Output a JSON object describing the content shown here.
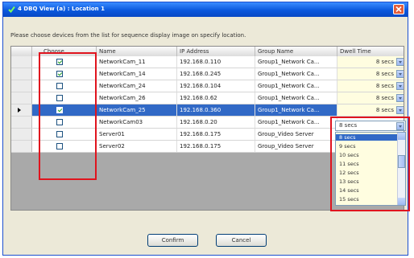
{
  "window": {
    "title": "4 DBQ View (a) : Location 1",
    "close_symbol": "×"
  },
  "instruction": "Please choose devices from the list for sequence display image on specify location.",
  "columns": {
    "choose": "Choose",
    "name": "Name",
    "ip": "IP Address",
    "group": "Group Name",
    "dwell": "Dwell Time"
  },
  "rows": [
    {
      "checked": true,
      "name": "NetworkCam_11",
      "ip": "192.168.0.110",
      "group": "Group1_Network Ca...",
      "dwell": "8 secs"
    },
    {
      "checked": true,
      "name": "NetworkCam_14",
      "ip": "192.168.0.245",
      "group": "Group1_Network Ca...",
      "dwell": "8 secs"
    },
    {
      "checked": false,
      "name": "NetworkCam_24",
      "ip": "192.168.0.104",
      "group": "Group1_Network Ca...",
      "dwell": "8 secs"
    },
    {
      "checked": false,
      "name": "NetworkCam_26",
      "ip": "192.168.0.62",
      "group": "Group1_Network Ca...",
      "dwell": "8 secs"
    },
    {
      "checked": true,
      "name": "NetworkCam_25",
      "ip": "192.168.0.360",
      "group": "Group1_Network Ca...",
      "dwell": "8 secs",
      "selected": true
    },
    {
      "checked": false,
      "name": "NetworkCam03",
      "ip": "192.168.0.20",
      "group": "Group1_Network Ca...",
      "dwell": ""
    },
    {
      "checked": false,
      "name": "Server01",
      "ip": "192.168.0.175",
      "group": "Group_Video Server",
      "dwell": ""
    },
    {
      "checked": false,
      "name": "Server02",
      "ip": "192.168.0.175",
      "group": "Group_Video Server",
      "dwell": ""
    }
  ],
  "dwell_dropdown": {
    "selected": "8 secs",
    "options": [
      "8 secs",
      "9 secs",
      "10 secs",
      "11 secs",
      "12 secs",
      "13 secs",
      "14 secs",
      "15 secs"
    ],
    "highlighted_option": "8 secs"
  },
  "buttons": {
    "confirm": "Confirm",
    "cancel": "Cancel"
  },
  "colors": {
    "highlight_box": "#e0141e",
    "selected_row": "#3169c6",
    "titlebar": "#0a58dd"
  }
}
